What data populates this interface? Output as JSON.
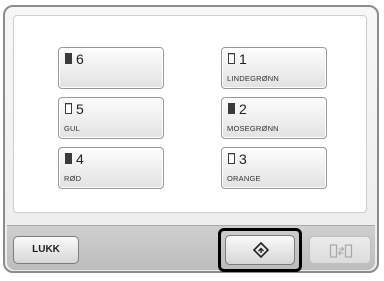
{
  "spools": [
    {
      "number": "6",
      "name": "",
      "filled": true
    },
    {
      "number": "1",
      "name": "LINDEGRØNN",
      "filled": false
    },
    {
      "number": "5",
      "name": "GUL",
      "filled": false
    },
    {
      "number": "2",
      "name": "MOSEGRØNN",
      "filled": true
    },
    {
      "number": "4",
      "name": "RØD",
      "filled": true
    },
    {
      "number": "3",
      "name": "ORANGE",
      "filled": false
    }
  ],
  "toolbar": {
    "close_label": "LUKK",
    "optimize_icon": "diamond-optimize-icon",
    "swap_icon": "spool-swap-icon",
    "swap_enabled": false
  },
  "colors": {
    "highlight": "#000000",
    "spool_filled": "#3a3a3a",
    "spool_empty": "#ffffff"
  }
}
